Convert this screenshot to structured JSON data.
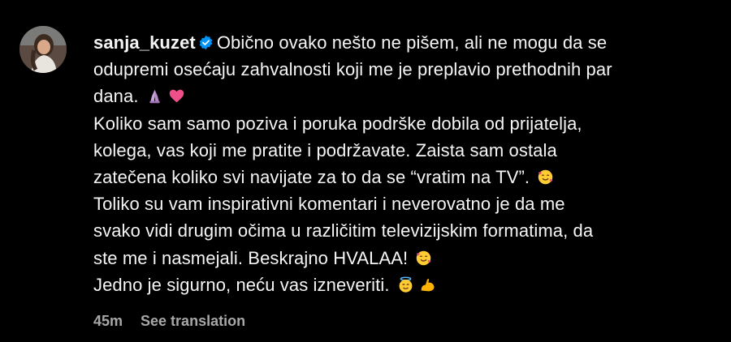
{
  "comment": {
    "username": "sanja_kuzet",
    "verified": true,
    "lines": [
      "Obično ovako nešto ne pišem, ali ne mogu da se",
      "odupremi osećaju zahvalnosti koji me je preplavio prethodnih par",
      "dana.",
      "Koliko sam samo poziva i poruka podrške dobila od prijatelja,",
      "kolega, vas koji me pratite i podržavate. Zaista sam ostala",
      "zatečena koliko svi navijate za to da se “vratim na TV”.",
      "Toliko su vam inspirativni komentari i neverovatno je da me",
      "svako vidi drugim očima u različitim televizijskim formatima, da",
      "ste me i nasmejali. Beskrajno HVALAA!",
      "Jedno je sigurno, neću vas izneveriti."
    ],
    "emojis": {
      "line3": [
        "praying-hands-emoji",
        "heart-emoji"
      ],
      "line6": [
        "smiling-face-with-hearts-emoji"
      ],
      "line9": [
        "smiling-face-with-hearts-emoji"
      ],
      "line10": [
        "halo-face-emoji",
        "flexed-biceps-emoji"
      ]
    },
    "timestamp": "45m",
    "see_translation": "See translation"
  },
  "colors": {
    "background": "#000000",
    "text": "#f5f5f5",
    "meta": "#a8a8a8",
    "verified_badge": "#0095f6"
  }
}
